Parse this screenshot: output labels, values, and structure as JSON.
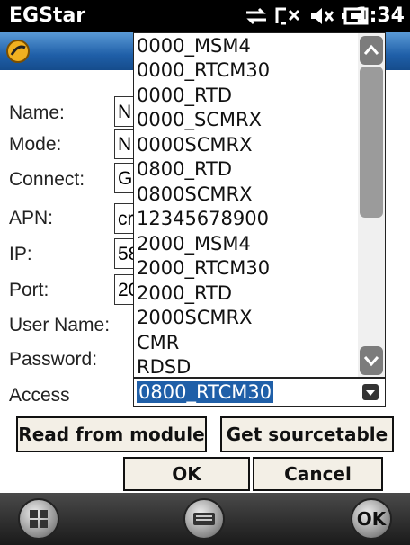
{
  "status_bar": {
    "app_title": "EGStar",
    "time": "1:34"
  },
  "form": {
    "labels": [
      "Name:",
      "Mode:",
      "Connect:",
      "APN:",
      "IP:",
      "Port:",
      "User Name:",
      "Password:",
      "Access"
    ],
    "visible_values": [
      "N",
      "N",
      "G",
      "cr",
      "58",
      "20",
      "",
      ""
    ]
  },
  "access_dropdown": {
    "selected": "0800_RTCM30",
    "options": [
      "0000_MSM4",
      "0000_RTCM30",
      "0000_RTD",
      "0000_SCMRX",
      "0000SCMRX",
      "0800_RTD",
      "0800SCMRX",
      "12345678900",
      "2000_MSM4",
      "2000_RTCM30",
      "2000_RTD",
      "2000SCMRX",
      "CMR",
      "RDSD"
    ]
  },
  "buttons": {
    "read_from_module": "Read from module",
    "get_sourcetable": "Get sourcetable",
    "ok": "OK",
    "cancel": "Cancel"
  },
  "bottom_bar": {
    "ok_label": "OK"
  },
  "colors": {
    "title_bar": "#1f5fa8",
    "selection": "#1f5fa8",
    "button_face": "#f3efe6"
  }
}
